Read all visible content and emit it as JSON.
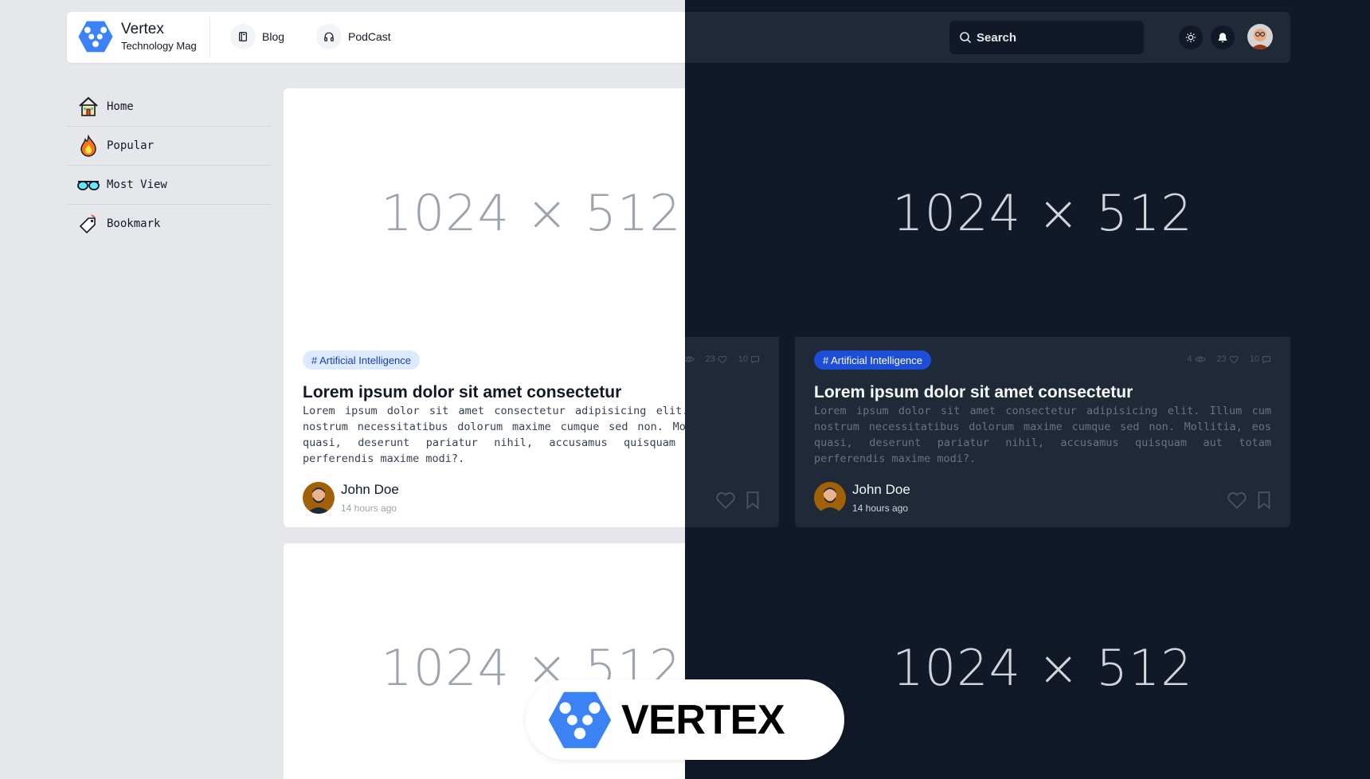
{
  "brand": {
    "name": "Vertex",
    "tagline": "Technology Mag",
    "logo_icon": "vertex-logo-icon",
    "color": "#3b82f6"
  },
  "nav": [
    {
      "label": "Blog",
      "icon": "book-icon"
    },
    {
      "label": "PodCast",
      "icon": "headphones-icon"
    }
  ],
  "search": {
    "placeholder": "Search",
    "icon": "search-icon"
  },
  "header_actions": {
    "theme_icon": "sun-icon",
    "notification_icon": "bell-icon",
    "avatar": "user-avatar"
  },
  "sidebar": {
    "items": [
      {
        "label": "Home",
        "icon": "house-icon"
      },
      {
        "label": "Popular",
        "icon": "fire-icon"
      },
      {
        "label": "Most View",
        "icon": "glasses-icon"
      },
      {
        "label": "Bookmark",
        "icon": "bookmark-tag-icon"
      }
    ]
  },
  "cards": [
    {
      "image_placeholder": "1024 × 512",
      "tag": "# Artificial Intelligence",
      "views": "4",
      "likes": "23",
      "comments": "10",
      "title": "Lorem ipsum dolor sit amet consectetur",
      "excerpt": "Lorem ipsum dolor sit amet consectetur adipisicing elit. Illum cum nostrum necessitatibus dolorum maxime cumque sed non. Mollitia, eos quasi, deserunt pariatur nihil, accusamus quisquam aut totam perferendis maxime modi?.",
      "author": "John Doe",
      "time": "14 hours ago"
    },
    {
      "image_placeholder": "1024 × 512"
    }
  ],
  "footer_badge": {
    "text": "VERTEX"
  },
  "colors": {
    "accent": "#3b82f6",
    "tag_light_bg": "#dbeafe",
    "tag_dark_bg": "#1d4ed8",
    "dark_bg": "#111827",
    "dark_surface": "#1f2937",
    "light_bg": "#e5e7eb"
  }
}
